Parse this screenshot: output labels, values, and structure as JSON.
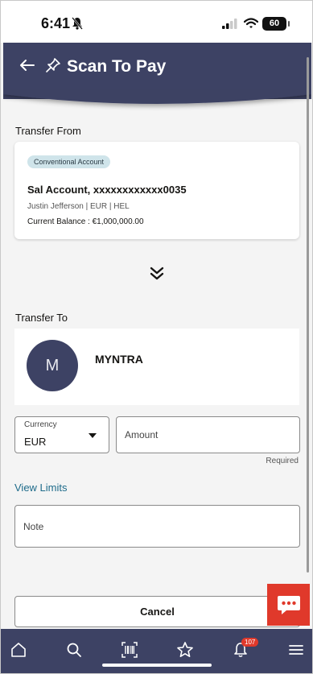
{
  "status_bar": {
    "time": "6:41",
    "battery": "60"
  },
  "header": {
    "title": "Scan To Pay"
  },
  "transfer_from": {
    "label": "Transfer From",
    "account_type": "Conventional Account",
    "account_name": "Sal Account, xxxxxxxxxxxx0035",
    "account_owner": "Justin Jefferson | EUR | HEL",
    "current_balance": "Current Balance : €1,000,000.00"
  },
  "transfer_to": {
    "label": "Transfer To",
    "avatar_initial": "M",
    "payee_name": "MYNTRA"
  },
  "currency": {
    "label": "Currency",
    "value": "EUR"
  },
  "amount": {
    "placeholder": "Amount",
    "hint": "Required"
  },
  "view_limits_label": "View Limits",
  "note": {
    "placeholder": "Note"
  },
  "cancel_label": "Cancel",
  "bottom_nav": {
    "items": [
      {
        "icon": "home-icon"
      },
      {
        "icon": "search-icon"
      },
      {
        "icon": "barcode-scan-icon"
      },
      {
        "icon": "star-icon"
      },
      {
        "icon": "bell-icon"
      },
      {
        "icon": "menu-icon"
      }
    ],
    "notification_count": "107"
  },
  "colors": {
    "header": "#3d4264",
    "accent_link": "#1e6b8a",
    "chat_button": "#e0392b",
    "badge_bg": "#cfe4ea"
  }
}
